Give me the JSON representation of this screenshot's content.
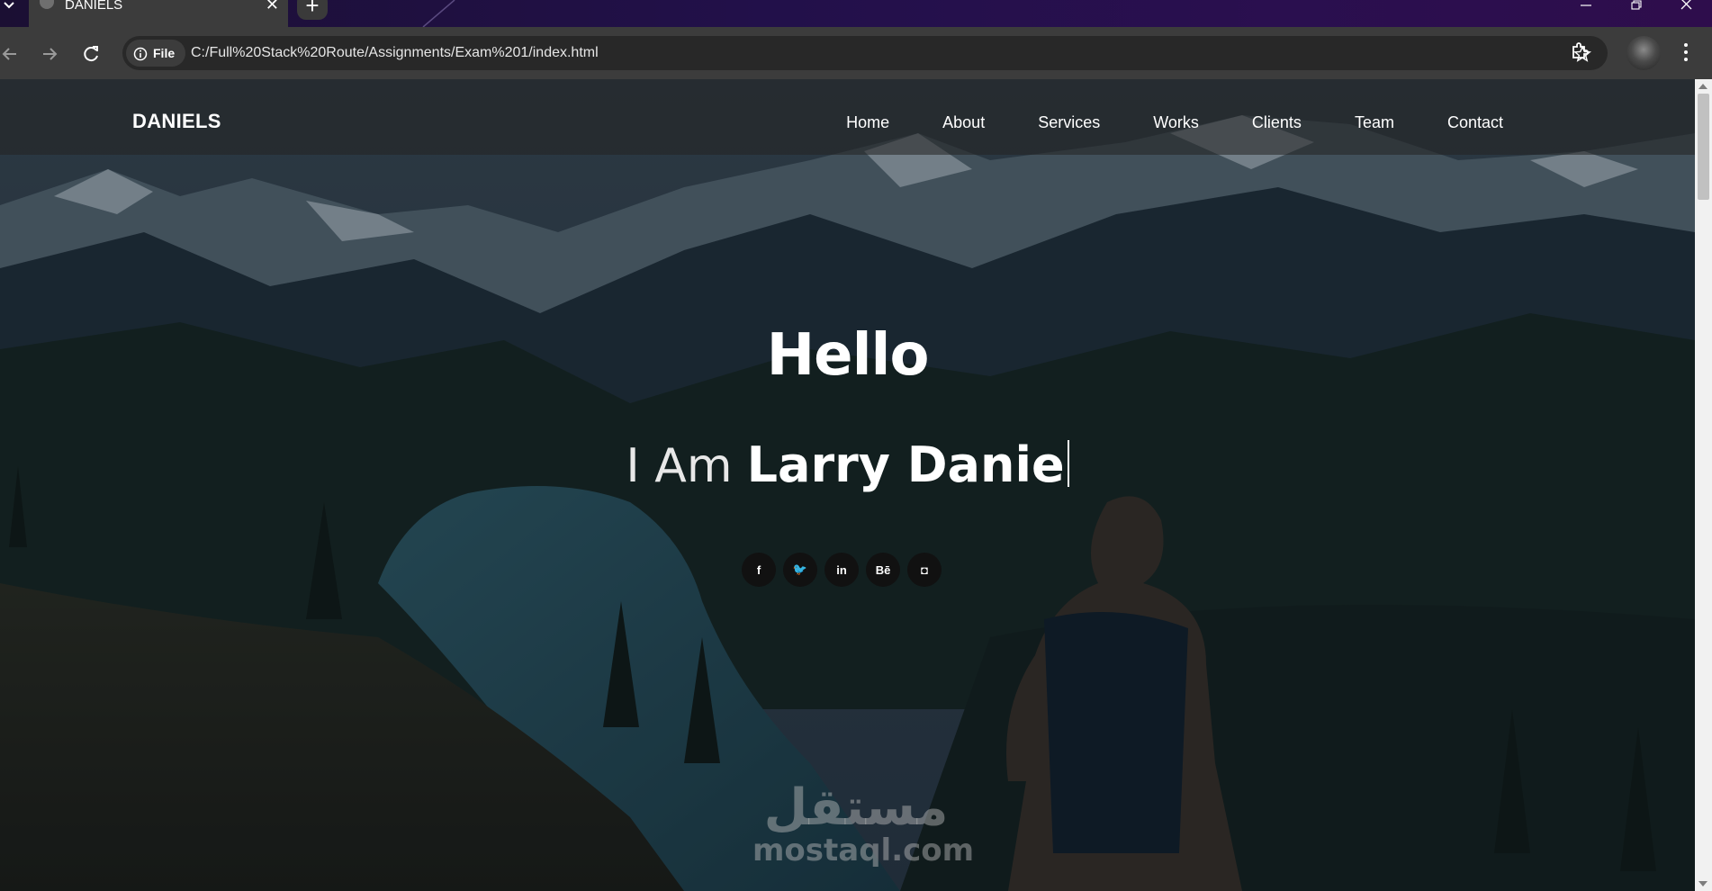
{
  "browser": {
    "tab_title": "DANIELS",
    "tab_close": "✕",
    "new_tab": "+",
    "info_chip_label": "File",
    "url": "C:/Full%20Stack%20Route/Assignments/Exam%201/index.html"
  },
  "site": {
    "brand": "DANIELS",
    "menu": [
      "Home",
      "About",
      "Services",
      "Works",
      "Clients",
      "Team",
      "Contact"
    ],
    "hero": {
      "greeting": "Hello",
      "intro_prefix": "I Am",
      "intro_name": "Larry Danie"
    },
    "social": [
      {
        "icon": "facebook-icon",
        "glyph": "f"
      },
      {
        "icon": "twitter-icon",
        "glyph": "🐦"
      },
      {
        "icon": "linkedin-icon",
        "glyph": "in"
      },
      {
        "icon": "behance-icon",
        "glyph": "Bē"
      },
      {
        "icon": "instagram-icon",
        "glyph": "◘"
      }
    ]
  },
  "watermark": {
    "arabic": "مستقل",
    "latin": "mostaql.com"
  },
  "colors": {
    "tabstrip": "#22104a",
    "toolbar": "#3c3c3c",
    "omnibox": "#282828",
    "hero_overlay": "#0d1f2b"
  }
}
